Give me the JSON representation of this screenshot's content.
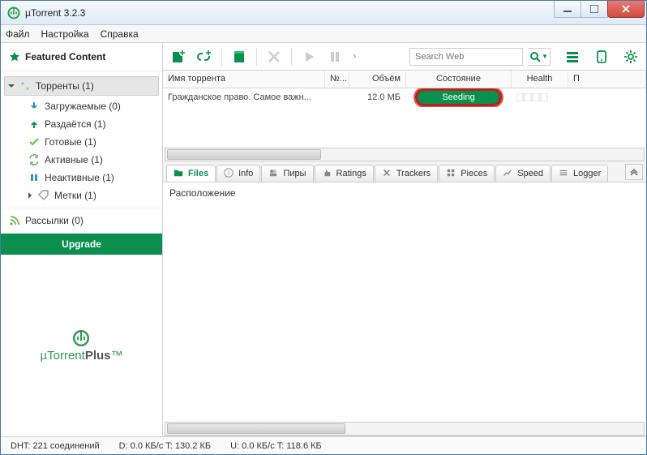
{
  "window": {
    "title": "µTorrent 3.2.3"
  },
  "menu": {
    "file": "Файл",
    "settings": "Настройка",
    "help": "Справка"
  },
  "sidebar": {
    "featured": "Featured Content",
    "root": "Торренты (1)",
    "items": [
      {
        "label": "Загружаемые (0)",
        "color": "#2f8fdc"
      },
      {
        "label": "Раздаётся (1)",
        "color": "#0b8f4e"
      },
      {
        "label": "Готовые (1)",
        "color": "#6abf3a"
      },
      {
        "label": "Активные (1)",
        "color": "#6bb36b"
      },
      {
        "label": "Неактивные (1)",
        "color": "#2f8fdc"
      },
      {
        "label": "Метки (1)",
        "color": "#9a9a9a"
      }
    ],
    "feeds": "Рассылки (0)",
    "upgrade": "Upgrade",
    "plus_a": "µTorrent",
    "plus_b": "Plus"
  },
  "search": {
    "placeholder": "Search Web"
  },
  "columns": {
    "name": "Имя торрента",
    "num": "№...",
    "size": "Объём",
    "state": "Состояние",
    "health": "Health",
    "p": "П"
  },
  "row": {
    "name": "Гражданское право. Самое важн...",
    "size": "12.0 МБ",
    "state": "Seeding"
  },
  "tabs": {
    "files": "Files",
    "info": "Info",
    "peers": "Пиры",
    "ratings": "Ratings",
    "trackers": "Trackers",
    "pieces": "Pieces",
    "speed": "Speed",
    "logger": "Logger"
  },
  "detail": {
    "location": "Расположение"
  },
  "status": {
    "dht": "DHT: 221 соединений",
    "down": "D: 0.0 КБ/с T: 130.2 КБ",
    "up": "U: 0.0 КБ/с T: 118.6 КБ"
  }
}
